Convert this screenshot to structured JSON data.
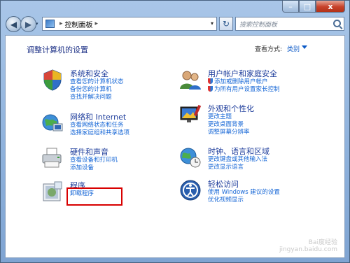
{
  "window": {
    "caption": {
      "minimize": "–",
      "maximize": "□",
      "close": "x"
    }
  },
  "nav": {
    "back": "◀",
    "forward": "▶",
    "recent": "▾"
  },
  "address": {
    "root_arrow": "▸",
    "path": [
      "控制面板"
    ],
    "sep": "▸",
    "dropdown": "▾"
  },
  "search": {
    "placeholder": "搜索控制面板"
  },
  "main": {
    "title": "调整计算机的设置",
    "view_by_label": "查看方式:",
    "view_by_value": "类别"
  },
  "categories": [
    {
      "title": "系统和安全",
      "links": [
        "查看您的计算机状态",
        "备份您的计算机",
        "查找并解决问题"
      ]
    },
    {
      "title": "网络和 Internet",
      "links": [
        "查看网络状态和任务",
        "选择家庭组和共享选项"
      ]
    },
    {
      "title": "硬件和声音",
      "links": [
        "查看设备和打印机",
        "添加设备"
      ]
    },
    {
      "title": "程序",
      "links": [
        "卸载程序"
      ]
    },
    {
      "title": "用户帐户和家庭安全",
      "links": [
        "添加或删除用户帐户",
        "为所有用户设置家长控制"
      ]
    },
    {
      "title": "外观和个性化",
      "links": [
        "更改主题",
        "更改桌面背景",
        "调整屏幕分辨率"
      ]
    },
    {
      "title": "时钟、语言和区域",
      "links": [
        "更改键盘或其他输入法",
        "更改显示语言"
      ]
    },
    {
      "title": "轻松访问",
      "links": [
        "使用 Windows 建议的设置",
        "优化视频显示"
      ]
    }
  ],
  "watermark": {
    "line1": "Bai度经验",
    "line2": "jingyan.baidu.com"
  }
}
